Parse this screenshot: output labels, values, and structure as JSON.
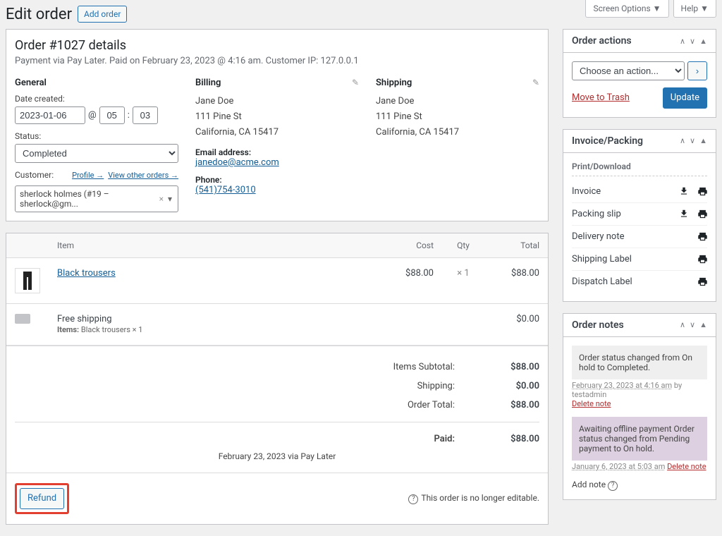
{
  "header": {
    "title": "Edit order",
    "add_button": "Add order",
    "screen_options": "Screen Options",
    "help": "Help"
  },
  "order": {
    "title_prefix": "Order #",
    "number": "1027",
    "title_suffix": " details",
    "subtitle": "Payment via Pay Later. Paid on February 23, 2023 @ 4:16 am. Customer IP: 127.0.0.1",
    "general_heading": "General",
    "date_label": "Date created:",
    "date": "2023-01-06",
    "at": "@",
    "hour": "05",
    "colon": ":",
    "minute": "03",
    "status_label": "Status:",
    "status": "Completed",
    "customer_label": "Customer:",
    "profile_link": "Profile →",
    "view_orders_link": "View other orders →",
    "customer_value": "sherlock holmes (#19 – sherlock@gm...",
    "billing_heading": "Billing",
    "billing_name": "Jane Doe",
    "billing_street": "111 Pine St",
    "billing_city": "California, CA 15417",
    "email_label": "Email address:",
    "email": "janedoe@acme.com",
    "phone_label": "Phone:",
    "phone": "(541)754-3010",
    "shipping_heading": "Shipping",
    "shipping_name": "Jane Doe",
    "shipping_street": "111 Pine St",
    "shipping_city": "California, CA 15417"
  },
  "items": {
    "head_item": "Item",
    "head_cost": "Cost",
    "head_qty": "Qty",
    "head_total": "Total",
    "line1_name": "Black trousers",
    "line1_cost": "$88.00",
    "line1_qty": "× 1",
    "line1_total": "$88.00",
    "ship_name": "Free shipping",
    "ship_items_label": "Items:",
    "ship_items": "Black trousers × 1",
    "ship_total": "$0.00",
    "subtotal_label": "Items Subtotal:",
    "subtotal": "$88.00",
    "shipping_label": "Shipping:",
    "shipping_total": "$0.00",
    "ordertotal_label": "Order Total:",
    "ordertotal": "$88.00",
    "paid_label": "Paid:",
    "paid": "$88.00",
    "paid_via": "February 23, 2023 via Pay Later",
    "refund_button": "Refund",
    "not_editable": "This order is no longer editable."
  },
  "actions": {
    "title": "Order actions",
    "choose": "Choose an action...",
    "trash": "Move to Trash",
    "update": "Update"
  },
  "invoice": {
    "title": "Invoice/Packing",
    "print_head": "Print/Download",
    "rows": [
      "Invoice",
      "Packing slip",
      "Delivery note",
      "Shipping Label",
      "Dispatch Label"
    ]
  },
  "notes": {
    "title": "Order notes",
    "n1_text": "Order status changed from On hold to Completed.",
    "n1_meta": "February 23, 2023 at 4:16 am",
    "n1_by": " by testadmin",
    "n1_delete": "Delete note",
    "n2_text": "Awaiting offline payment Order status changed from Pending payment to On hold.",
    "n2_meta": "January 6, 2023 at 5:03 am",
    "n2_delete": "Delete note",
    "add_label": "Add note"
  }
}
